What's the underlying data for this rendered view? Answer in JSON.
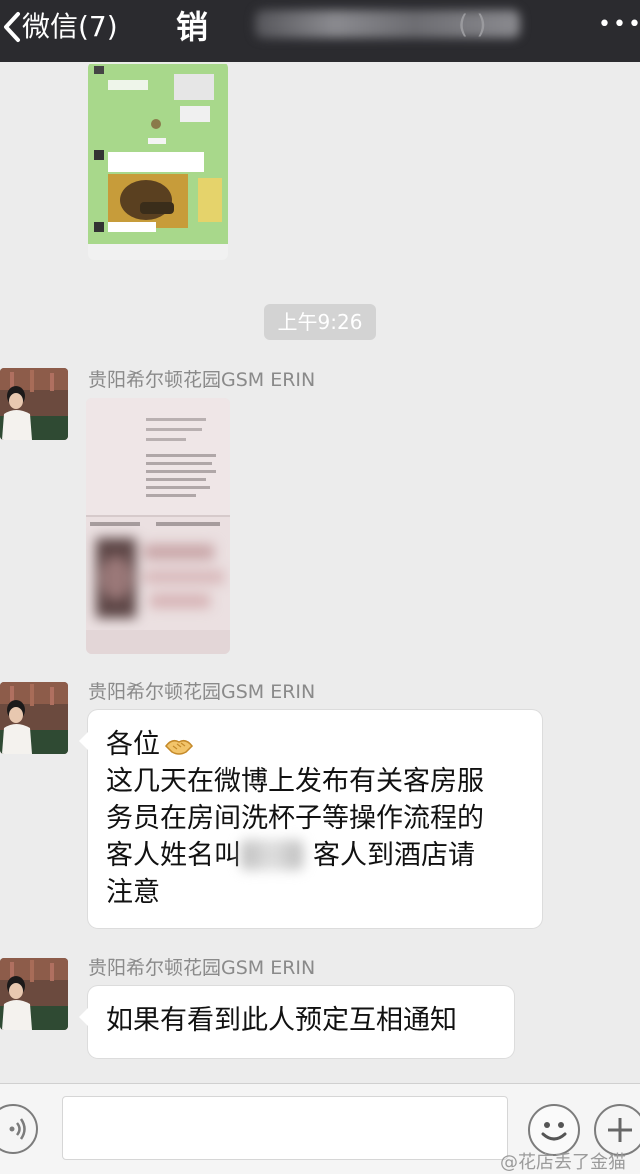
{
  "header": {
    "back_label": "微信(7)",
    "chat_title": "销",
    "more_label": "•••"
  },
  "messages": {
    "timestamp": "上午9:26",
    "sender_name": "贵阳希尔顿花园GSM ERIN",
    "announcement": {
      "greeting": "各位",
      "line1": "这几天在微博上发布有关客房服",
      "line2": "务员在房间洗杯子等操作流程的",
      "line3_before": "客人姓名叫",
      "line3_after": "客人到酒店请",
      "line4": "注意"
    },
    "followup": "如果有看到此人预定互相通知"
  },
  "watermark": {
    "prefix": "@",
    "text": "花店丢了金猫"
  },
  "colors": {
    "top_bar": "#2b2b2f",
    "chat_background": "#ececec",
    "bubble": "#ffffff",
    "timestamp_pill": "#d3d3d3"
  }
}
